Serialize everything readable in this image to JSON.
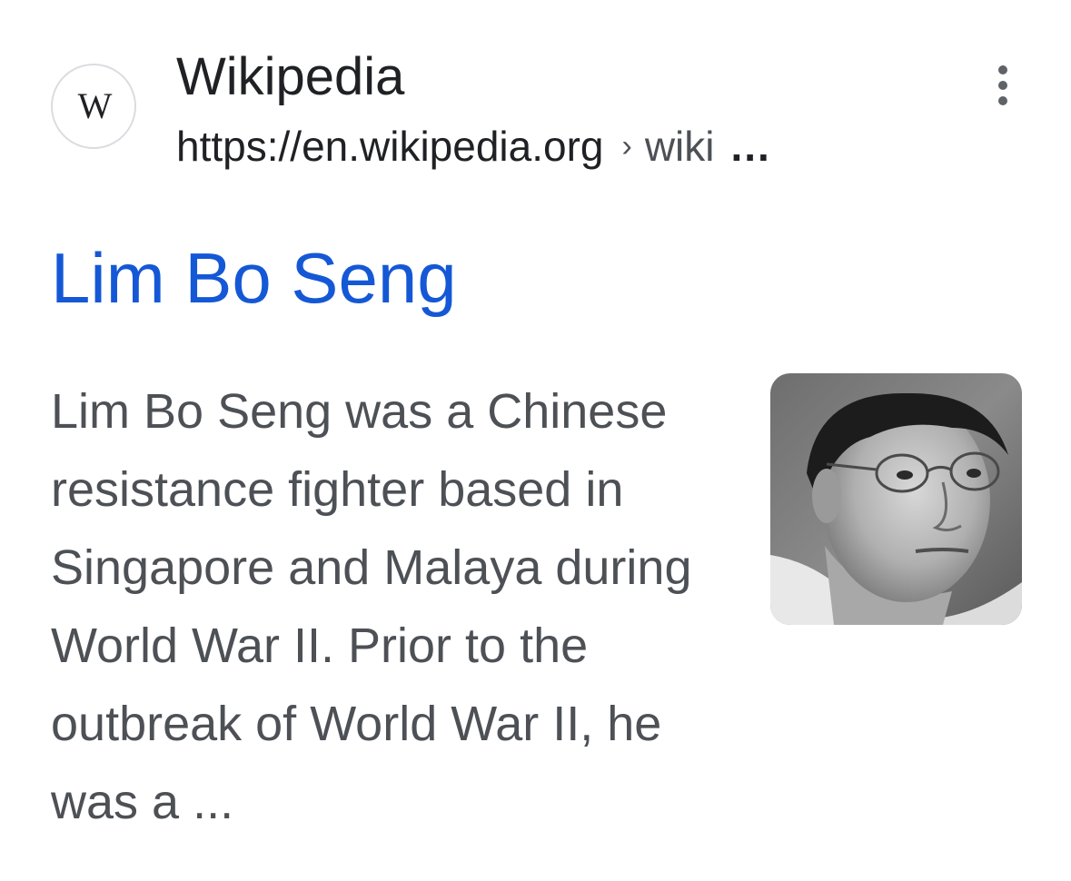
{
  "result": {
    "favicon_icon": "wikipedia-w-icon",
    "favicon_letter": "W",
    "site_name": "Wikipedia",
    "url_domain": "https://en.wikipedia.org",
    "url_separator": "›",
    "url_path": "wiki",
    "url_ellipsis": "...",
    "menu_icon": "more-vert-icon",
    "title": "Lim Bo Seng",
    "snippet": "Lim Bo Seng was a Chinese resistance fighter based in Singapore and Malaya during World War II. Prior to the outbreak of World War II, he was a ...",
    "thumbnail_icon": "portrait-photo"
  },
  "colors": {
    "title_link": "#1558d6",
    "site_name": "#202124",
    "snippet_text": "#4d5156"
  }
}
